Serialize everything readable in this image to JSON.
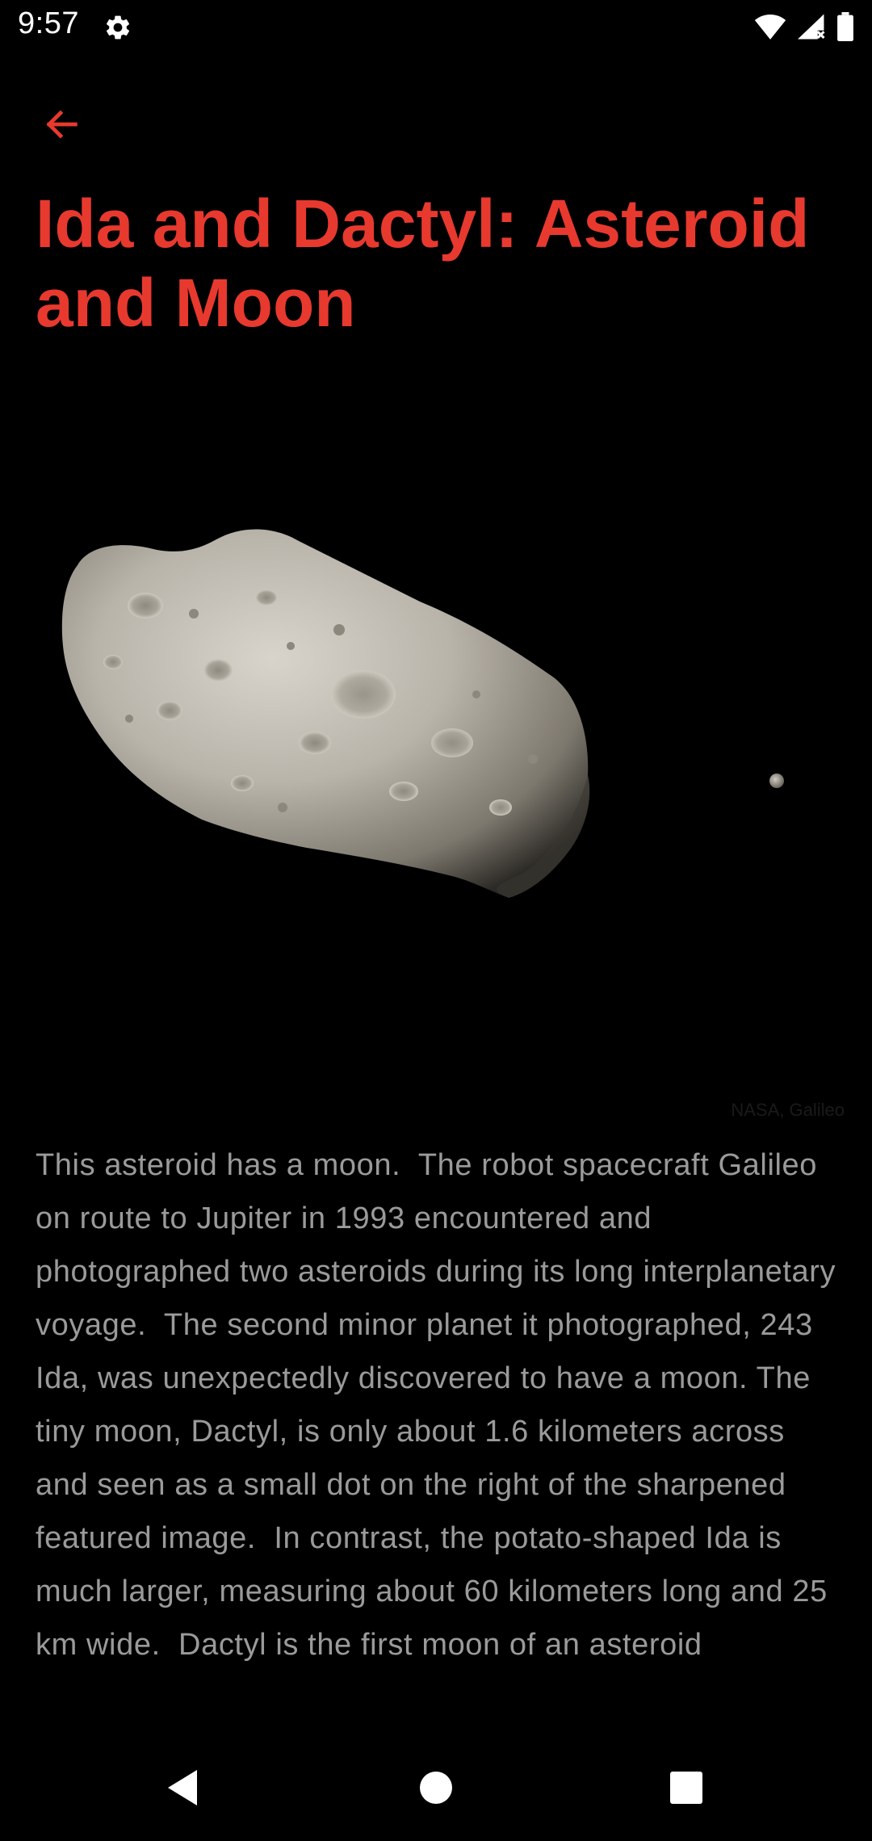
{
  "status_bar": {
    "time": "9:57",
    "icons": [
      "gear-icon",
      "wifi-icon",
      "cellular-icon",
      "battery-icon"
    ]
  },
  "toolbar": {
    "back_icon": "arrow-left-icon",
    "accent_color": "#e8392f"
  },
  "article": {
    "title": "Ida and Dactyl: Asteroid and Moon",
    "image_credit": "NASA, Galileo",
    "body": "This asteroid has a moon.  The robot spacecraft Galileo on route to Jupiter in 1993 encountered and photographed two asteroids during its long interplanetary voyage.  The second minor planet it photographed, 243 Ida, was unexpectedly discovered to have a moon. The tiny moon, Dactyl, is only about 1.6 kilometers across and seen as a small dot on the right of the sharpened featured image.  In contrast, the potato-shaped Ida is much larger, measuring about 60 kilometers long and 25 km wide.  Dactyl is the first moon of an asteroid"
  },
  "nav_bar": {
    "icons": [
      "back-triangle-icon",
      "home-circle-icon",
      "recents-square-icon"
    ]
  }
}
